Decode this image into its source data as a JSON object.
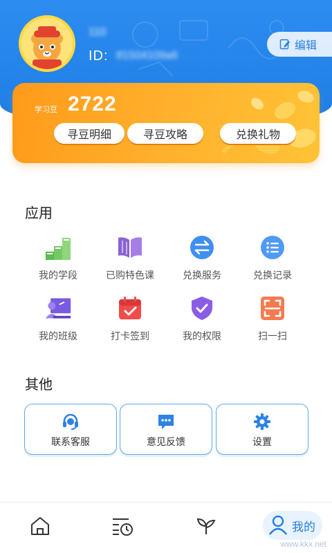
{
  "profile": {
    "name": "110",
    "id_label": "ID:",
    "id_value": "tf1504109a6",
    "edit_label": "编辑"
  },
  "beans": {
    "label": "学习豆",
    "count": "2722",
    "buttons": [
      "寻豆明细",
      "寻豆攻略",
      "兑换礼物"
    ]
  },
  "apps": {
    "title": "应用",
    "items": [
      {
        "label": "我的学段",
        "icon": "stairs-icon"
      },
      {
        "label": "已购特色课",
        "icon": "book-icon"
      },
      {
        "label": "兑换服务",
        "icon": "exchange-icon"
      },
      {
        "label": "兑换记录",
        "icon": "list-icon"
      },
      {
        "label": "我的班级",
        "icon": "class-icon"
      },
      {
        "label": "打卡签到",
        "icon": "calendar-check-icon"
      },
      {
        "label": "我的权限",
        "icon": "shield-check-icon"
      },
      {
        "label": "扫一扫",
        "icon": "scan-icon"
      }
    ]
  },
  "other": {
    "title": "其他",
    "items": [
      {
        "label": "联系客服",
        "icon": "headset-icon"
      },
      {
        "label": "意见反馈",
        "icon": "feedback-icon"
      },
      {
        "label": "设置",
        "icon": "gear-icon"
      }
    ]
  },
  "nav": {
    "items": [
      {
        "icon": "home-icon"
      },
      {
        "icon": "history-icon"
      },
      {
        "icon": "sprout-icon"
      },
      {
        "icon": "user-icon",
        "label": "我的",
        "active": true
      }
    ]
  },
  "watermark": "www.kkx.net",
  "colors": {
    "primary": "#1f7fe6",
    "orange": "#ffa326"
  }
}
